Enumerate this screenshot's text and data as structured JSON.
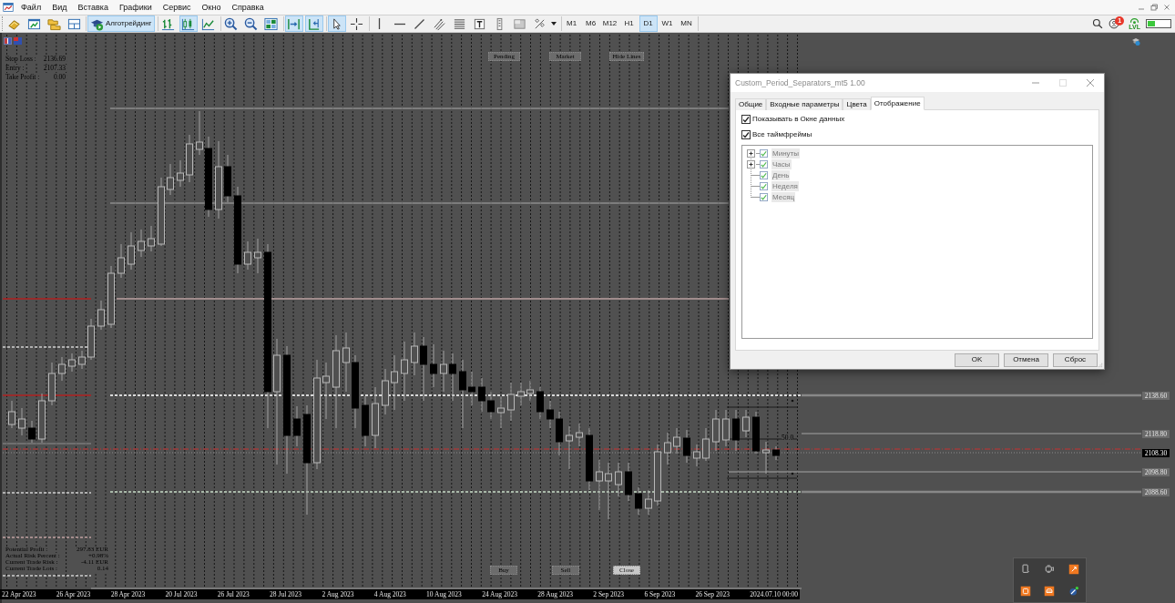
{
  "menu_bar": {
    "items": [
      "Файл",
      "Вид",
      "Вставка",
      "Графики",
      "Сервис",
      "Окно",
      "Справка"
    ]
  },
  "toolbar": {
    "file_tools": [
      {
        "pressed": false
      },
      {
        "pressed": false
      },
      {
        "pressed": false
      },
      {
        "pressed": false
      }
    ],
    "algotrading": {
      "label": "Алготрейдинг",
      "on": true
    },
    "chart_tools": [
      {
        "pressed": false
      },
      {
        "pressed": true
      },
      {
        "pressed": false
      },
      {
        "pressed": false
      },
      {
        "pressed": false
      },
      {
        "pressed": false
      }
    ],
    "view_tools": [
      {
        "pressed": true
      },
      {
        "pressed": true
      }
    ],
    "drawing_tools": [
      {
        "pressed": true
      },
      {
        "pressed": false
      },
      {
        "pressed": false
      },
      {
        "pressed": false
      },
      {
        "pressed": false
      },
      {
        "pressed": false
      },
      {
        "pressed": false
      },
      {
        "pressed": false
      },
      {
        "pressed": false
      },
      {
        "pressed": false
      },
      {
        "pressed": false
      }
    ],
    "timeframes": [
      {
        "label": "M1",
        "selected": false
      },
      {
        "label": "M6",
        "selected": false
      },
      {
        "label": "M12",
        "selected": false
      },
      {
        "label": "H1",
        "selected": false
      },
      {
        "label": "D1",
        "selected": true
      },
      {
        "label": "W1",
        "selected": false
      },
      {
        "label": "MN",
        "selected": false
      }
    ],
    "notifications": {
      "badge": "1"
    },
    "connection": {
      "label": "LVL"
    }
  },
  "chart": {
    "order_info": [
      {
        "label": "Stop Loss :",
        "value": "2136.69"
      },
      {
        "label": "Entry :",
        "value": "2107.33"
      },
      {
        "label": "Take Profit :",
        "value": "0.00"
      }
    ],
    "order_buttons": [
      "Pending",
      "Market",
      "Hide Lines"
    ],
    "level_label": "50.0",
    "price_labels": [
      {
        "text": "2138.60",
        "kind": "level"
      },
      {
        "text": "2118.80",
        "kind": "level"
      },
      {
        "text": "2108.30",
        "kind": "current"
      },
      {
        "text": "2098.80",
        "kind": "level"
      },
      {
        "text": "2088.60",
        "kind": "level"
      }
    ],
    "stats": [
      {
        "label": "Potential Profit :",
        "value": "297.83 EUR"
      },
      {
        "label": "Actual Risk Percent :",
        "value": "+0.98%"
      },
      {
        "label": "Current Trade Risk :",
        "value": "-4.11 EUR"
      },
      {
        "label": "Current Trade Lots :",
        "value": "0.14"
      }
    ],
    "trade_buttons": [
      {
        "label": "Buy",
        "highlighted": false
      },
      {
        "label": "Sell",
        "highlighted": false
      },
      {
        "label": "Close",
        "highlighted": true
      }
    ],
    "time_axis": [
      "22 Apr 2023",
      "26 Apr 2023",
      "28 Apr 2023",
      "20 Jul 2023",
      "26 Jul 2023",
      "28 Jul 2023",
      "2 Aug 2023",
      "4 Aug 2023",
      "10 Aug 2023",
      "24 Aug 2023",
      "28 Aug 2023",
      "2 Sep 2023",
      "6 Sep 2023",
      "26 Sep 2023",
      "2024.07.10 00:00"
    ]
  },
  "dialog": {
    "title": "Custom_Period_Separators_mt5 1.00",
    "tabs": [
      {
        "label": "Общие",
        "selected": false
      },
      {
        "label": "Входные параметры",
        "selected": false
      },
      {
        "label": "Цвета",
        "selected": false
      },
      {
        "label": "Отображение",
        "selected": true
      }
    ],
    "options": [
      {
        "label": "Показывать в Окне данных",
        "checked": true
      },
      {
        "label": "Все таймфреймы",
        "checked": true
      }
    ],
    "timeframes_tree": [
      {
        "label": "Минуты",
        "checked": true,
        "expander": true,
        "disabled": true
      },
      {
        "label": "Часы",
        "checked": true,
        "expander": true,
        "disabled": true
      },
      {
        "label": "День",
        "checked": true,
        "expander": false,
        "disabled": true
      },
      {
        "label": "Неделя",
        "checked": true,
        "expander": false,
        "disabled": true
      },
      {
        "label": "Месяц",
        "checked": true,
        "expander": false,
        "disabled": true
      }
    ],
    "buttons": [
      "OK",
      "Отмена",
      "Сброс"
    ]
  }
}
